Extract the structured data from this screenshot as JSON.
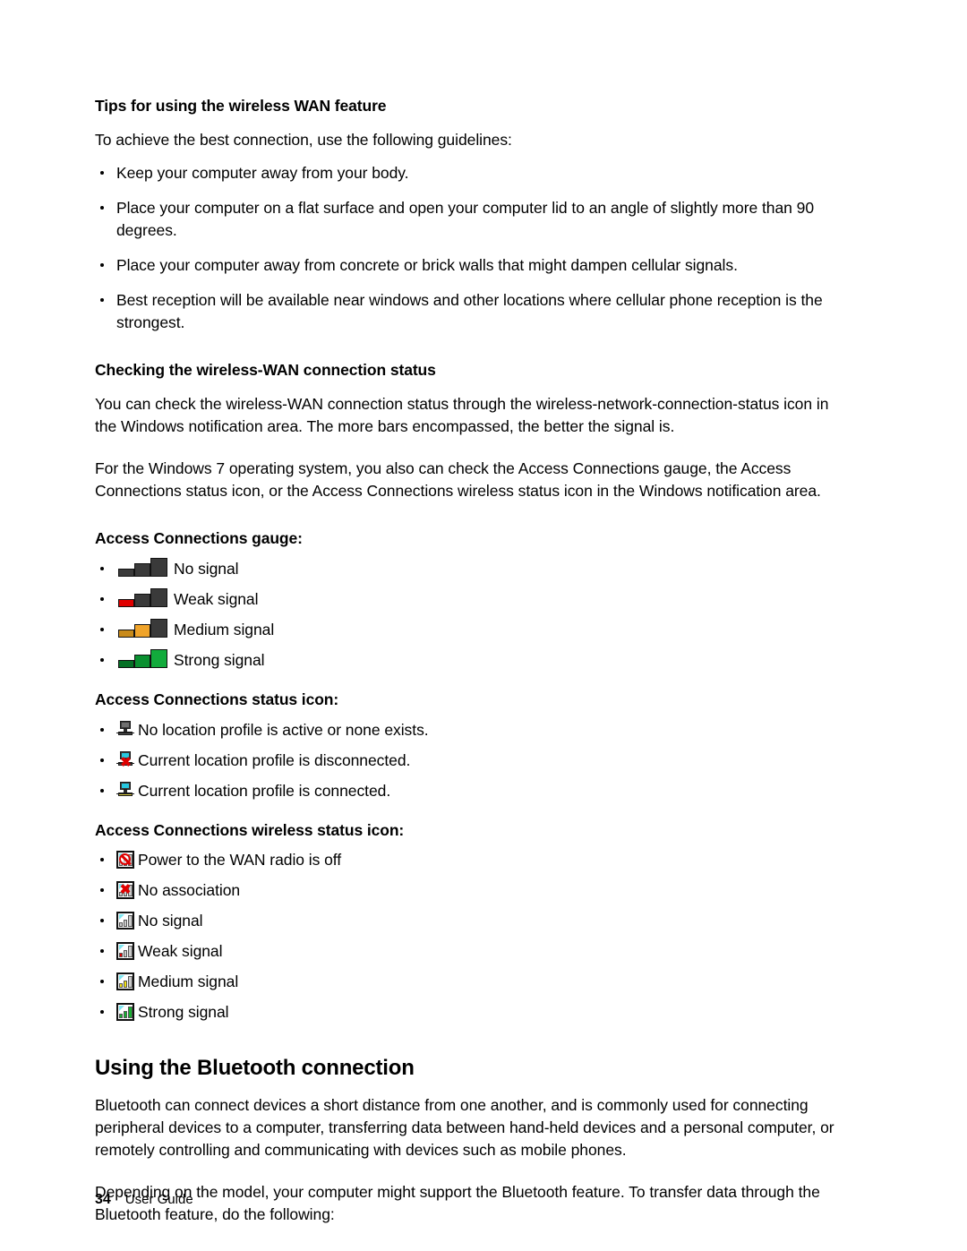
{
  "document": {
    "page_number": "34",
    "footer_label": "User Guide"
  },
  "sections": {
    "tips": {
      "heading": "Tips for using the wireless WAN feature",
      "intro": "To achieve the best connection, use the following guidelines:",
      "bullets": [
        "Keep your computer away from your body.",
        "Place your computer on a flat surface and open your computer lid to an angle of slightly more than 90 degrees.",
        "Place your computer away from concrete or brick walls that might dampen cellular signals.",
        "Best reception will be available near windows and other locations where cellular phone reception is the strongest."
      ]
    },
    "checking": {
      "heading": "Checking the wireless-WAN connection status",
      "paragraph1": "You can check the wireless-WAN connection status through the wireless-network-connection-status icon in the Windows notification area. The more bars encompassed, the better the signal is.",
      "paragraph2": "For the Windows 7 operating system, you also can check the Access Connections gauge, the Access Connections status icon, or the Access Connections wireless status icon in the Windows notification area."
    },
    "gauge": {
      "heading": "Access Connections gauge:",
      "items": [
        {
          "icon": "gauge-no-signal-icon",
          "label": "No signal",
          "level": 0,
          "color": "#3a3a3a"
        },
        {
          "icon": "gauge-weak-signal-icon",
          "label": "Weak signal",
          "level": 1,
          "color": "#e00000"
        },
        {
          "icon": "gauge-medium-signal-icon",
          "label": "Medium signal",
          "level": 2,
          "color": "#f0a42a"
        },
        {
          "icon": "gauge-strong-signal-icon",
          "label": "Strong signal",
          "level": 3,
          "color": "#0a9030"
        }
      ]
    },
    "status_icon": {
      "heading": "Access Connections status icon:",
      "items": [
        {
          "icon": "status-no-profile-icon",
          "label": "No location profile is active or none exists."
        },
        {
          "icon": "status-disconnected-icon",
          "label": "Current location profile is disconnected."
        },
        {
          "icon": "status-connected-icon",
          "label": "Current location profile is connected."
        }
      ]
    },
    "wireless_status_icon": {
      "heading": "Access Connections wireless status icon:",
      "items": [
        {
          "icon": "wireless-radio-off-icon",
          "label": "Power to the WAN radio is off",
          "level": 0,
          "color": "#c9c9c9"
        },
        {
          "icon": "wireless-no-association-icon",
          "label": "No association",
          "level": 0,
          "color": "#c9c9c9"
        },
        {
          "icon": "wireless-no-signal-icon",
          "label": "No signal",
          "level": 0,
          "color": "#c9c9c9"
        },
        {
          "icon": "wireless-weak-signal-icon",
          "label": "Weak signal",
          "level": 1,
          "color": "#e00000"
        },
        {
          "icon": "wireless-medium-signal-icon",
          "label": "Medium signal",
          "level": 2,
          "color": "#f0e010"
        },
        {
          "icon": "wireless-strong-signal-icon",
          "label": "Strong signal",
          "level": 3,
          "color": "#16b030"
        }
      ]
    },
    "bluetooth": {
      "heading": "Using the Bluetooth connection",
      "paragraph1": "Bluetooth can connect devices a short distance from one another, and is commonly used for connecting peripheral devices to a computer, transferring data between hand-held devices and a personal computer, or remotely controlling and communicating with devices such as mobile phones.",
      "paragraph2": "Depending on the model, your computer might support the Bluetooth feature. To transfer data through the Bluetooth feature, do the following:"
    }
  }
}
